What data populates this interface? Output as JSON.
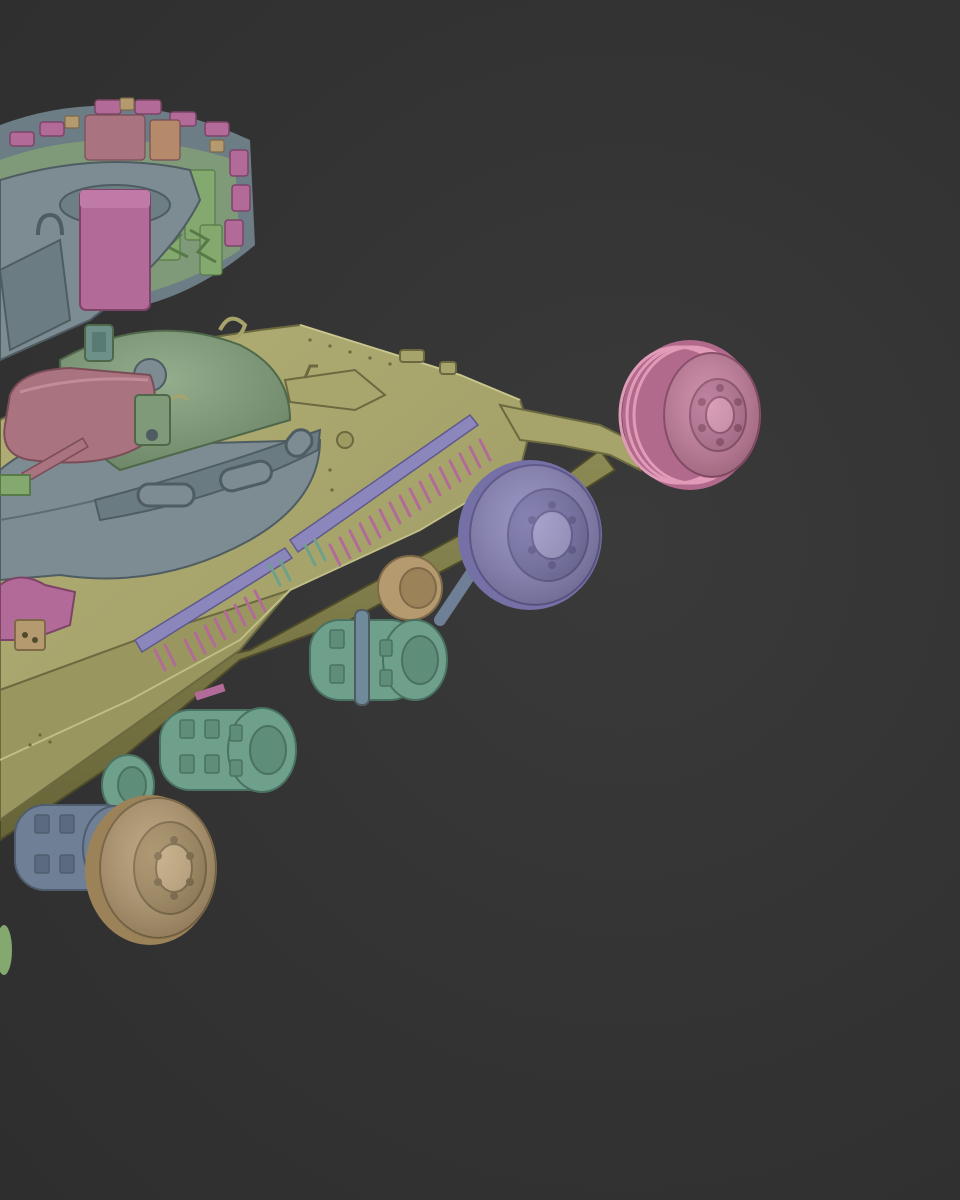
{
  "scene": {
    "subject": "3d-tank-model-clay-render",
    "palette": {
      "background": "#333333",
      "hull": "#a6a46a",
      "hull_dark": "#7f7d4c",
      "hull_shadow": "#5e5c36",
      "turret": "#7c8c92",
      "turret_dark": "#5d6c73",
      "dome": "#7e9a78",
      "mantlet": "#a9737f",
      "magenta": "#b26a98",
      "purple": "#8b86bb",
      "pink": "#c8809f",
      "teal": "#6fa08c",
      "tan": "#b59a70",
      "steel": "#6f7f95",
      "green": "#84a96e",
      "lavender": "#b58fc0"
    },
    "parts": [
      {
        "name": "hull",
        "color_key": "hull"
      },
      {
        "name": "turret",
        "color_key": "turret"
      },
      {
        "name": "commander-cupola",
        "color_key": "dome"
      },
      {
        "name": "gun-mantlet",
        "color_key": "mantlet"
      },
      {
        "name": "track-links",
        "color_key": "magenta"
      },
      {
        "name": "idler-wheel",
        "color_key": "pink"
      },
      {
        "name": "drive-sprocket",
        "color_key": "purple"
      },
      {
        "name": "road-wheels",
        "color_key": "tan"
      },
      {
        "name": "suspension-bogies",
        "color_key": "teal"
      }
    ]
  }
}
